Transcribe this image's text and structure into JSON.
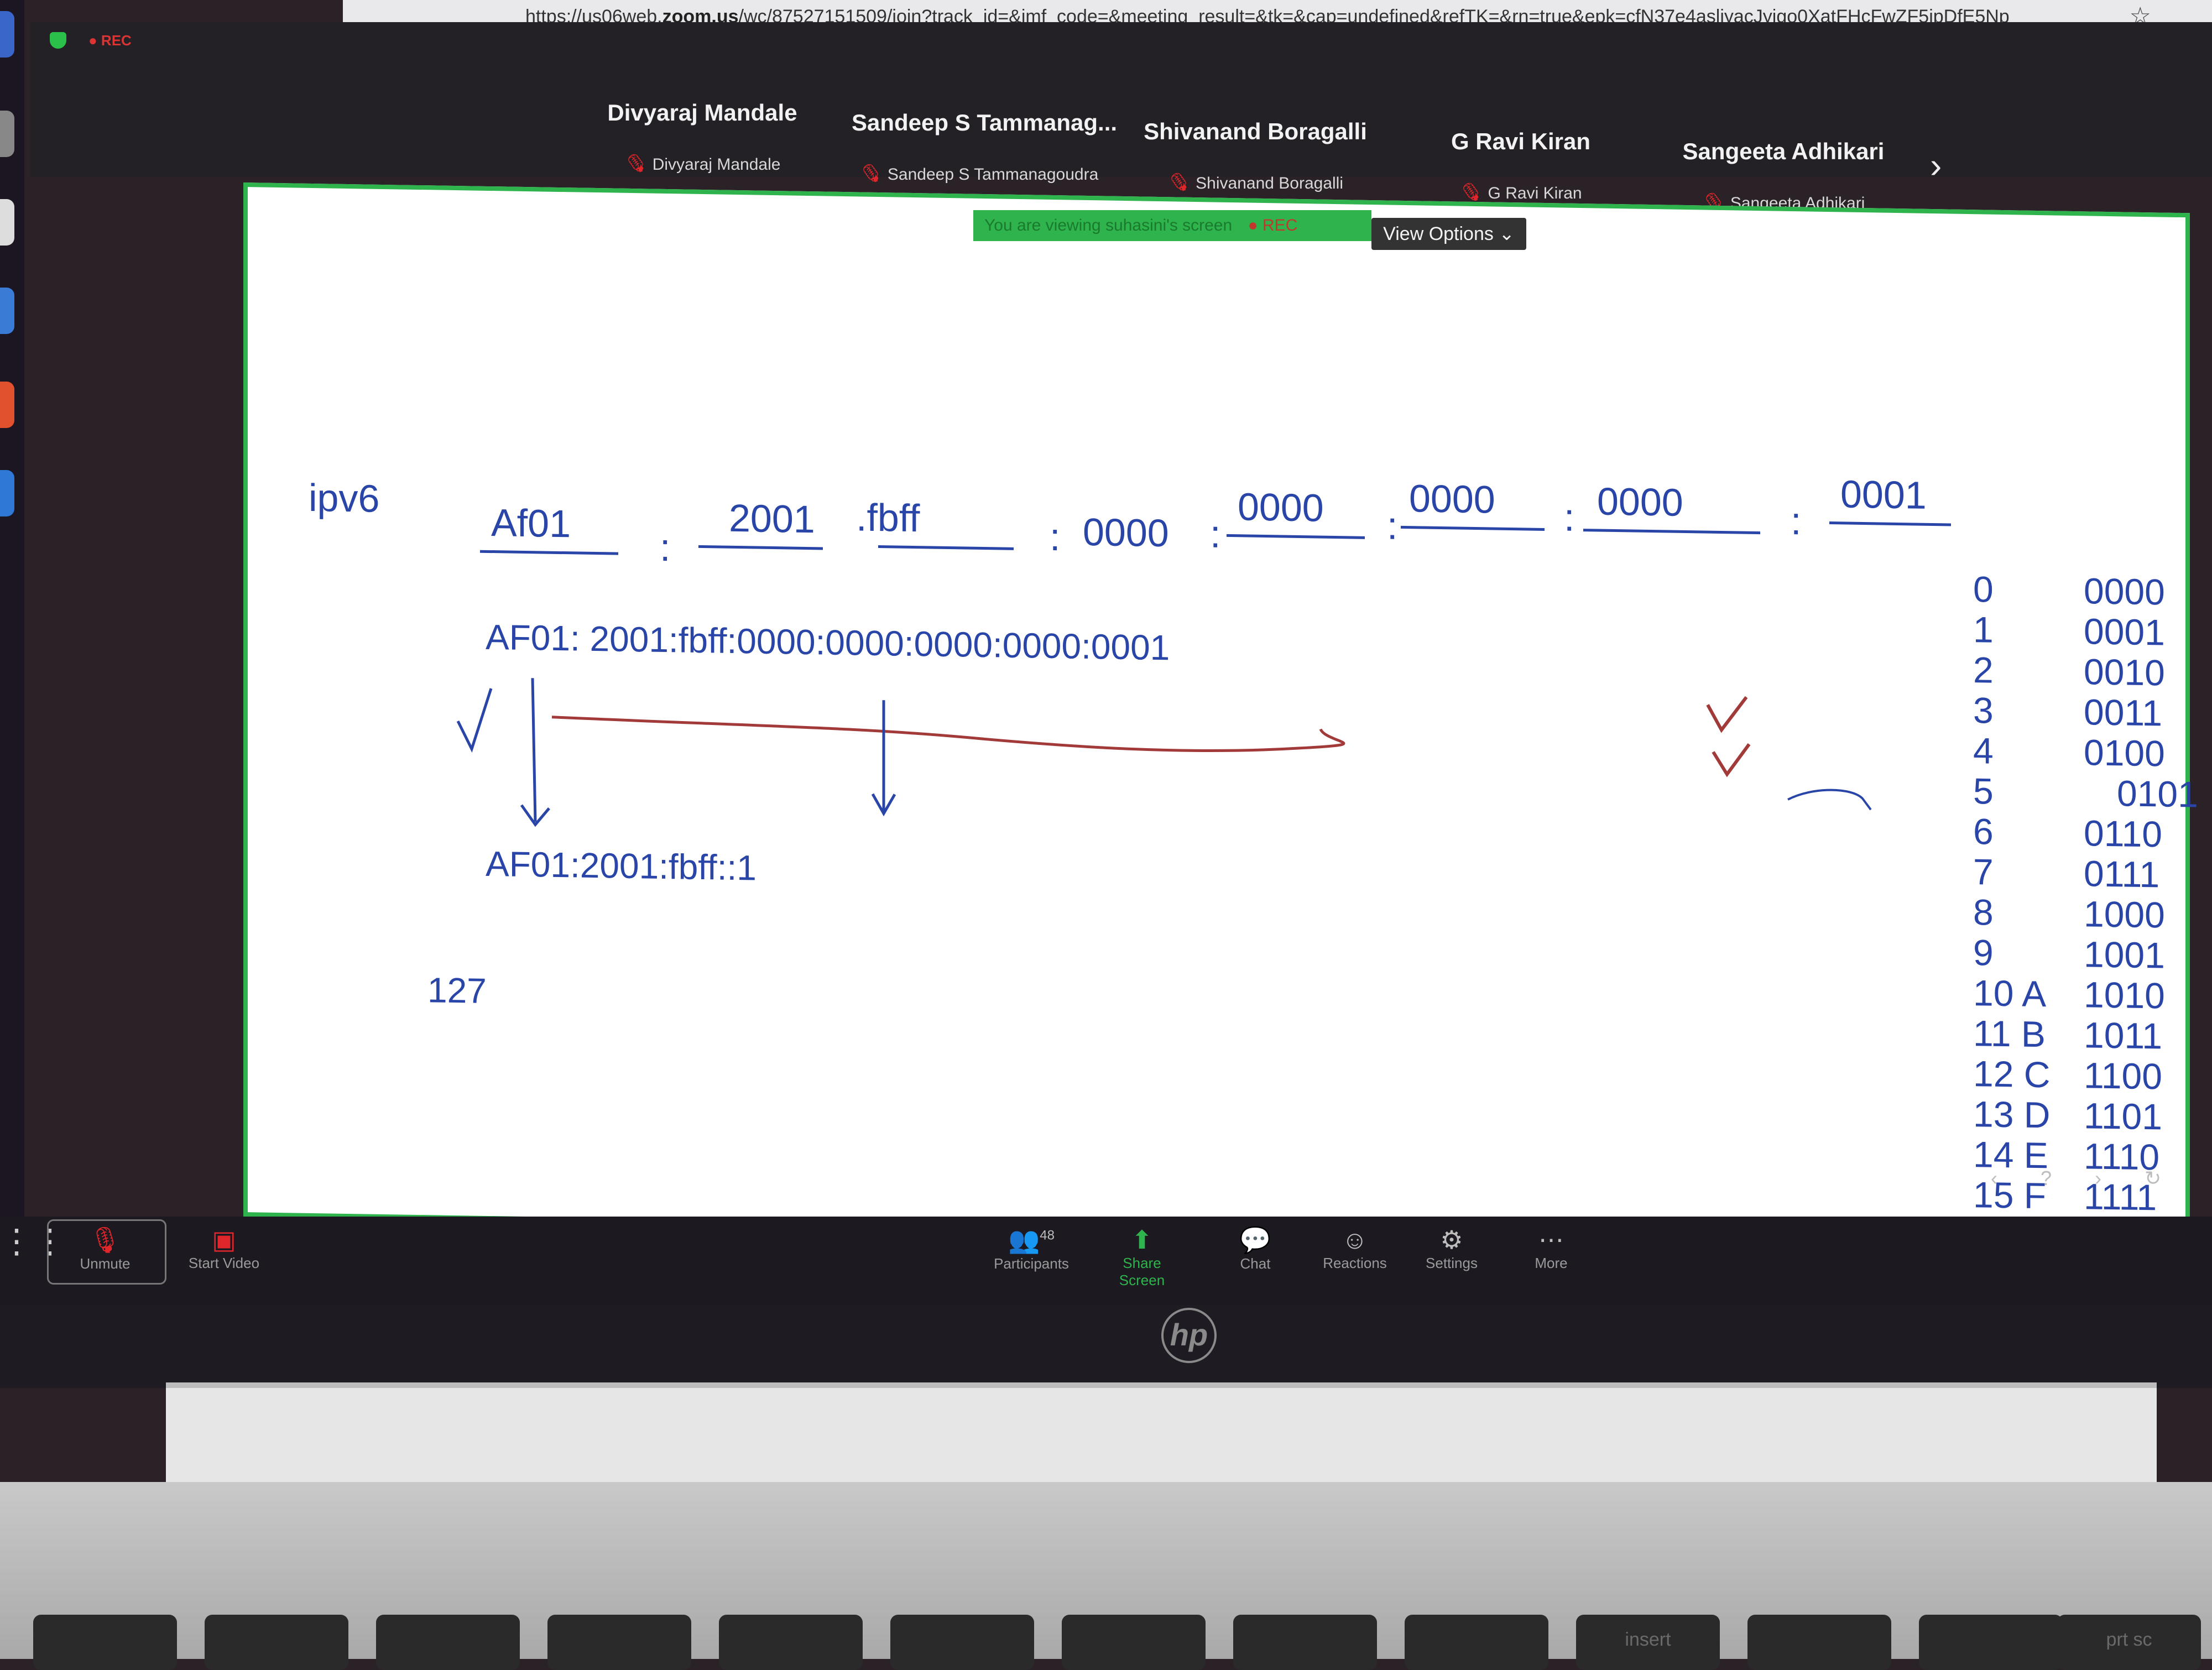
{
  "browser": {
    "url_prefix": "https://us06web.",
    "url_host": "zoom.us",
    "url_rest": "/wc/87527151509/join?track_id=&jmf_code=&meeting_result=&tk=&cap=undefined&refTK=&rn=true&epk=cfN37e4asljyacJyigo0XatFHcFwZF5ipDfE5Np",
    "star_icon": "☆"
  },
  "meeting": {
    "rec_label": "● REC",
    "participants": [
      {
        "name": "Divyaraj Mandale",
        "subname": "Divyaraj Mandale"
      },
      {
        "name": "Sandeep S Tammanag...",
        "subname": "Sandeep S Tammanagoudra"
      },
      {
        "name": "Shivanand Boragalli",
        "subname": "Shivanand Boragalli"
      },
      {
        "name": "G Ravi Kiran",
        "subname": "G Ravi Kiran"
      },
      {
        "name": "Sangeeta Adhikari",
        "subname": "Sangeeta Adhikari"
      }
    ],
    "next_icon": "›",
    "viewing_banner": "You are viewing suhasini's screen",
    "viewing_rec": "● REC",
    "view_options": "View Options ⌄"
  },
  "whiteboard": {
    "title": "ipv6",
    "groups": [
      "Af01",
      "2001",
      ".fbff",
      "0000",
      "0000",
      "0000",
      "0000",
      "0001"
    ],
    "separator": ":",
    "full_address": "AF01: 2001:fbff:0000:0000:0000:0000:0001",
    "compressed_address": "AF01:2001:fbff::1",
    "number_note": "127",
    "hex_table": [
      {
        "dec": "0",
        "bin": "0000"
      },
      {
        "dec": "1",
        "bin": "0001"
      },
      {
        "dec": "2",
        "bin": "0010"
      },
      {
        "dec": "3",
        "bin": "0011"
      },
      {
        "dec": "4",
        "bin": "0100"
      },
      {
        "dec": "5",
        "bin": "0101"
      },
      {
        "dec": "6",
        "bin": "0110"
      },
      {
        "dec": "7",
        "bin": "0111"
      },
      {
        "dec": "8",
        "bin": "1000"
      },
      {
        "dec": "9",
        "bin": "1001"
      },
      {
        "dec": "10 A",
        "bin": "1010"
      },
      {
        "dec": "11 B",
        "bin": "1011"
      },
      {
        "dec": "12 C",
        "bin": "1100"
      },
      {
        "dec": "13 D",
        "bin": "1101"
      },
      {
        "dec": "14 E",
        "bin": "1110"
      },
      {
        "dec": "15 F",
        "bin": "1111"
      }
    ],
    "slide_nav": "‹ ? › ↻"
  },
  "toolbar": {
    "unmute": "Unmute",
    "start_video": "Start Video",
    "participants": "Participants",
    "participants_count": "48",
    "share_screen": "Share Screen",
    "chat": "Chat",
    "reactions": "Reactions",
    "settings": "Settings",
    "more": "More"
  },
  "laptop": {
    "brand": "hp",
    "keys": [
      "",
      "",
      "",
      "",
      "",
      "",
      "",
      "",
      "",
      "insert",
      "",
      "",
      "prt sc"
    ]
  },
  "colors": {
    "ink_blue": "#2a45a8",
    "ink_red": "#a33a3a",
    "zoom_green": "#2fb34c",
    "mic_red": "#e0262a"
  }
}
